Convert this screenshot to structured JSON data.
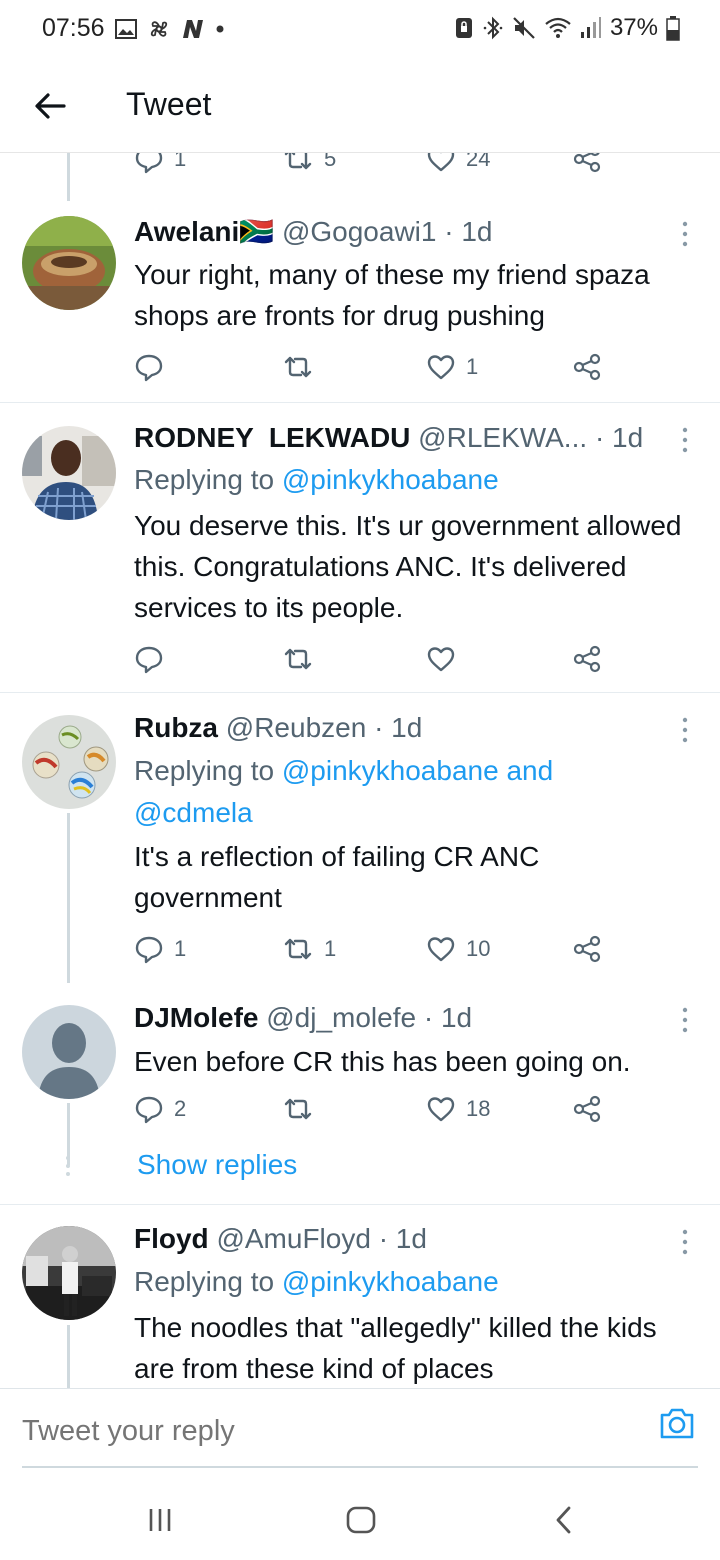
{
  "status_bar": {
    "time": "07:56",
    "battery": "37%",
    "left_icons": [
      "gallery-icon",
      "fan-icon",
      "n-app-icon",
      "dot-icon"
    ],
    "right_icons": [
      "vpn-lock-icon",
      "bluetooth-icon",
      "mute-icon",
      "wifi-icon",
      "signal-icon",
      "battery-icon"
    ]
  },
  "header": {
    "title": "Tweet"
  },
  "partial_actions": {
    "reply_count": "1",
    "retweet_count": "5",
    "like_count": "24"
  },
  "tweets": [
    {
      "name": "Awelani🇿🇦",
      "handle": "@Gogoawi1",
      "time": "· 1d",
      "replying_prefix": "",
      "replying_to": "",
      "text": "Your right, many of these my friend spaza shops are fronts for drug pushing",
      "reply_count": "",
      "retweet_count": "",
      "like_count": "1"
    },
    {
      "name": "RODNEY  LEKWADU",
      "handle": "@RLEKWA...",
      "time": "· 1d",
      "replying_prefix": "Replying to ",
      "replying_to": "@pinkykhoabane",
      "text": "You deserve this. It's ur government allowed this. Congratulations ANC. It's delivered services to its people.",
      "reply_count": "",
      "retweet_count": "",
      "like_count": ""
    },
    {
      "name": "Rubza",
      "handle": "@Reubzen",
      "time": "· 1d",
      "replying_prefix": "Replying to ",
      "replying_to": "@pinkykhoabane and",
      "replying_to_2": "@cdmela",
      "text": "It's a reflection of failing CR ANC government",
      "reply_count": "1",
      "retweet_count": "1",
      "like_count": "10"
    },
    {
      "name": "DJMolefe",
      "handle": "@dj_molefe",
      "time": "· 1d",
      "text": "Even before CR this has been going on.",
      "reply_count": "2",
      "retweet_count": "",
      "like_count": "18",
      "show_replies": "Show replies"
    },
    {
      "name": "Floyd",
      "handle": "@AmuFloyd",
      "time": "· 1d",
      "replying_prefix": "Replying to ",
      "replying_to": "@pinkykhoabane",
      "text": "The noodles that \"allegedly\" killed the kids are from these kind of places"
    }
  ],
  "reply_bar": {
    "placeholder": "Tweet your reply"
  },
  "colors": {
    "link": "#1d9bf0",
    "secondary_text": "#536471",
    "thread_line": "#cfd9de"
  }
}
